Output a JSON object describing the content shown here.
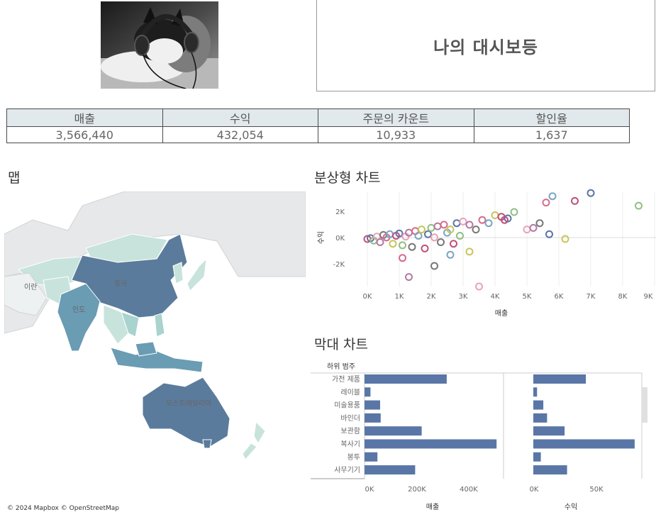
{
  "header": {
    "title": "나의 대시보등"
  },
  "kpis": {
    "headers": [
      "매출",
      "수익",
      "주문의 카운트",
      "할인율"
    ],
    "values": [
      "3,566,440",
      "432,054",
      "10,933",
      "1,637"
    ]
  },
  "map": {
    "title": "맵",
    "credit": "© 2024 Mapbox  © OpenStreetMap",
    "labels": [
      "이란",
      "인도",
      "중국",
      "오스트레일리아"
    ]
  },
  "scatter": {
    "title": "분상형 차트",
    "xlabel": "매출",
    "ylabel": "수익",
    "xticks": [
      "0K",
      "1K",
      "2K",
      "3K",
      "4K",
      "5K",
      "6K",
      "7K",
      "8K",
      "9K"
    ],
    "yticks": [
      "2K",
      "0K",
      "-2K"
    ]
  },
  "bar": {
    "title": "막대 차트",
    "header": "하위 범주",
    "categories": [
      "가전 제품",
      "레이블",
      "미술용품",
      "바인더",
      "보관함",
      "복사기",
      "봉투",
      "사무기기"
    ],
    "sales_label": "매출",
    "profit_label": "수익",
    "sales_ticks": [
      "0K",
      "200K",
      "400K"
    ],
    "profit_ticks": [
      "0K",
      "50K"
    ]
  },
  "chart_data": [
    {
      "type": "scatter",
      "title": "분상형 차트",
      "xlabel": "매출",
      "ylabel": "수익",
      "xlim": [
        0,
        9000
      ],
      "ylim": [
        -3000,
        3000
      ],
      "x": [
        0,
        100,
        200,
        300,
        400,
        500,
        600,
        700,
        800,
        900,
        1000,
        1100,
        1200,
        1300,
        1400,
        1500,
        1600,
        1700,
        1800,
        1900,
        2000,
        2100,
        2200,
        2300,
        2400,
        2500,
        2600,
        2700,
        2800,
        2900,
        3000,
        3200,
        3400,
        3600,
        3800,
        4000,
        4200,
        4400,
        4600,
        5000,
        5200,
        5400,
        5600,
        5800,
        6200,
        6500,
        7000,
        8500,
        3500,
        1300,
        2100,
        1100,
        2600,
        3200,
        4300,
        5700
      ],
      "y": [
        0,
        50,
        -100,
        150,
        -200,
        250,
        100,
        300,
        -300,
        200,
        350,
        -400,
        150,
        400,
        -500,
        500,
        200,
        600,
        -600,
        300,
        700,
        100,
        800,
        -200,
        900,
        400,
        600,
        -300,
        1000,
        200,
        1100,
        900,
        600,
        1200,
        1000,
        1500,
        1400,
        1300,
        1700,
        600,
        700,
        1000,
        2300,
        2700,
        0,
        2400,
        2900,
        2100,
        -3000,
        -2400,
        -1700,
        -1200,
        -1000,
        -800,
        1200,
        300
      ]
    },
    {
      "type": "bar",
      "title": "매출",
      "categories": [
        "가전 제품",
        "레이블",
        "미술용품",
        "바인더",
        "보관함",
        "복사기",
        "봉투",
        "사무기기"
      ],
      "values": [
        305000,
        22000,
        58000,
        60000,
        212000,
        490000,
        48000,
        188000
      ],
      "xlim": [
        0,
        500000
      ]
    },
    {
      "type": "bar",
      "title": "수익",
      "categories": [
        "가전 제품",
        "레이블",
        "미술용품",
        "바인더",
        "보관함",
        "복사기",
        "봉투",
        "사무기기"
      ],
      "values": [
        42000,
        3000,
        8000,
        11000,
        25000,
        81000,
        6000,
        27000
      ],
      "xlim": [
        0,
        85000
      ]
    }
  ],
  "colors": {
    "bar": "#5a76a7",
    "kpi_header_bg": "#e2e9ed",
    "map_dark": "#5b7b9c",
    "map_mid": "#6a9cb3",
    "map_light": "#c7e3dc"
  }
}
